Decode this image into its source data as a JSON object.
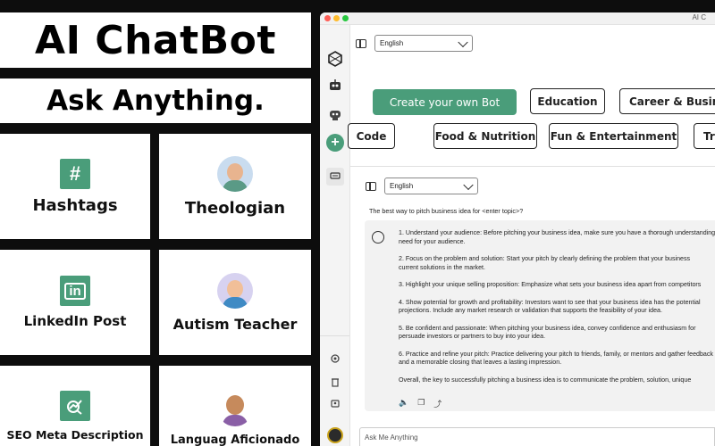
{
  "promo": {
    "title": "AI ChatBot",
    "subtitle": "Ask Anything.",
    "cards": [
      {
        "label": "Hashtags",
        "icon": "hashtag-icon",
        "glyph": "#"
      },
      {
        "label": "Theologian",
        "icon": "theologian-avatar"
      },
      {
        "label": "LinkedIn Post",
        "icon": "linkedin-icon",
        "glyph": "in"
      },
      {
        "label": "Autism Teacher",
        "icon": "teacher-avatar"
      },
      {
        "label": "SEO Meta Description",
        "icon": "seo-chart-icon"
      },
      {
        "label": "Languag Aficionado",
        "icon": "language-avatar"
      }
    ]
  },
  "window": {
    "title": "AI C"
  },
  "top": {
    "language": "English",
    "chips": {
      "create": "Create your own Bot",
      "education": "Education",
      "career": "Career & Business",
      "code": "Code",
      "food": "Food & Nutrition",
      "fun": "Fun & Entertainment",
      "travel": "Tra"
    }
  },
  "chat": {
    "language": "English",
    "prompt": "The best way to pitch business idea for <enter topic>?",
    "answer": [
      "1. Understand your audience: Before pitching your business idea, make sure you have a thorough understanding",
      "need for your audience.",
      "",
      "2. Focus on the problem and solution: Start your pitch by clearly defining the problem that your business",
      "current solutions in the market.",
      "",
      "3. Highlight your unique selling proposition: Emphasize what sets your business idea apart from competitors",
      "",
      "4. Show potential for growth and profitability: Investors want to see that your business idea has the potential",
      "projections. Include any market research or validation that supports the feasibility of your idea.",
      "",
      "5. Be confident and passionate: When pitching your business idea, convey confidence and enthusiasm for",
      "persuade investors or partners to buy into your idea.",
      "",
      "6. Practice and refine your pitch: Practice delivering your pitch to friends, family, or mentors and gather feedback",
      "and a memorable closing that leaves a lasting impression.",
      "",
      "Overall, the key to successfully pitching a business idea is to communicate the problem, solution, unique"
    ],
    "input_placeholder": "Ask Me Anything"
  },
  "colors": {
    "accent": "#4a9d7a",
    "background": "#0d0d0d"
  }
}
